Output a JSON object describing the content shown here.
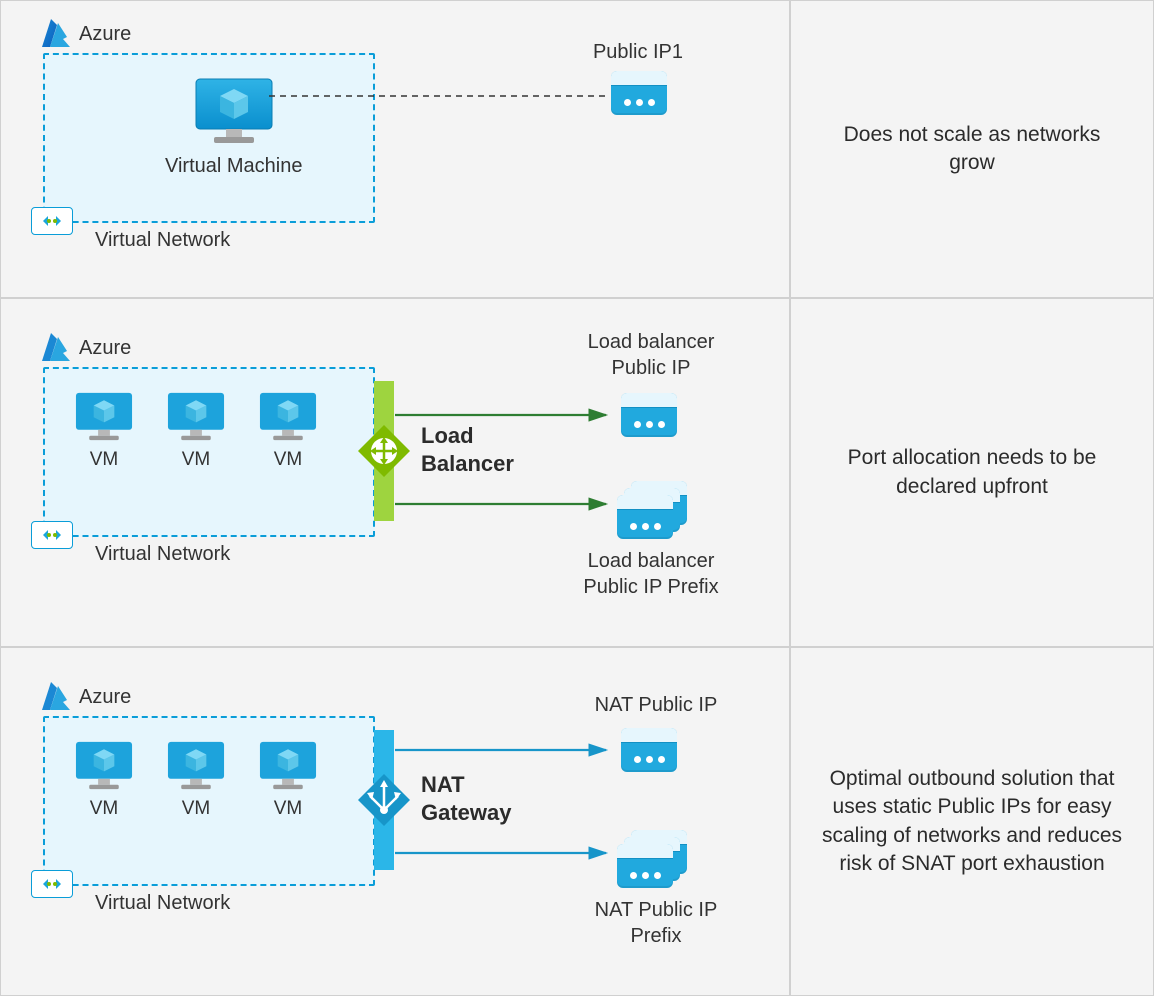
{
  "brand": "Azure",
  "row1": {
    "vm_label": "Virtual Machine",
    "vnet_label": "Virtual Network",
    "ip_label": "Public IP1",
    "description": "Does not scale as networks grow"
  },
  "row2": {
    "vm_label": "VM",
    "vnet_label": "Virtual Network",
    "gateway_label_line1": "Load",
    "gateway_label_line2": "Balancer",
    "ip1_line1": "Load balancer",
    "ip1_line2": "Public IP",
    "ip2_line1": "Load balancer",
    "ip2_line2": "Public IP Prefix",
    "description": "Port allocation needs to be declared upfront"
  },
  "row3": {
    "vm_label": "VM",
    "vnet_label": "Virtual Network",
    "gateway_label_line1": "NAT",
    "gateway_label_line2": "Gateway",
    "ip1_label": "NAT Public IP",
    "ip2_line1": "NAT Public IP",
    "ip2_line2": "Prefix",
    "description": "Optimal outbound solution that uses static Public IPs for easy scaling of networks and reduces risk of SNAT port exhaustion"
  },
  "colors": {
    "azure_blue": "#0a9dd8",
    "panel_bg": "#f4f4f4",
    "vnet_bg": "#e6f6fd",
    "lb_green": "#84c225",
    "lb_dark": "#2e7d32",
    "nat_teal": "#199fd6"
  }
}
